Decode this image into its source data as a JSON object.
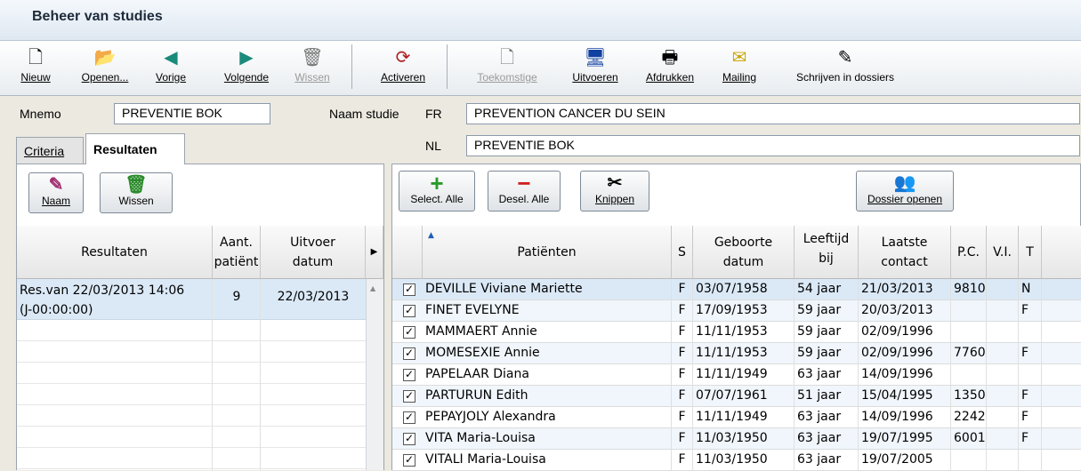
{
  "window": {
    "title": "Beheer van studies"
  },
  "toolbar": {
    "nieuw": "Nieuw",
    "openen": "Openen...",
    "vorige": "Vorige",
    "volgende": "Volgende",
    "wissen": "Wissen",
    "activeren": "Activeren",
    "toekomstige": "Toekomstige",
    "uitvoeren": "Uitvoeren",
    "afdrukken": "Afdrukken",
    "mailing": "Mailing",
    "schrijven": "Schrijven in dossiers"
  },
  "form": {
    "mnemo_label": "Mnemo",
    "mnemo_value": "PREVENTIE BOK",
    "naam_label": "Naam studie",
    "fr_label": "FR",
    "fr_value": "PREVENTION CANCER DU SEIN",
    "nl_label": "NL",
    "nl_value": "PREVENTIE BOK"
  },
  "tabs": {
    "criteria": "Criteria",
    "resultaten": "Resultaten"
  },
  "left_panel": {
    "buttons": {
      "naam": "Naam",
      "wissen": "Wissen"
    },
    "headers": {
      "resultaten": "Resultaten",
      "aant": "Aant. patiënt",
      "uitvoer": "Uitvoer datum"
    },
    "rows": [
      {
        "label_line1": "Res.van 22/03/2013 14:06",
        "label_line2": "(J-00:00:00)",
        "count": "9",
        "date": "22/03/2013"
      }
    ]
  },
  "right_panel": {
    "buttons": {
      "select_all": "Select. Alle",
      "desel_all": "Desel. Alle",
      "knippen": "Knippen",
      "dossier": "Dossier openen"
    },
    "headers": {
      "patienten": "Patiënten",
      "s": "S",
      "geboorte": "Geboorte datum",
      "leeftijd": "Leeftijd bij",
      "laatste": "Laatste contact",
      "pc": "P.C.",
      "vi": "V.I.",
      "t": "T"
    },
    "rows": [
      {
        "name": "DEVILLE Viviane Mariette",
        "s": "F",
        "dob": "03/07/1958",
        "age": "54 jaar",
        "last": "21/03/2013",
        "pc": "9810",
        "vi": "",
        "t": "N",
        "checked": true
      },
      {
        "name": "FINET EVELYNE",
        "s": "F",
        "dob": "17/09/1953",
        "age": "59 jaar",
        "last": "20/03/2013",
        "pc": "",
        "vi": "",
        "t": "F",
        "checked": true
      },
      {
        "name": "MAMMAERT Annie",
        "s": "F",
        "dob": "11/11/1953",
        "age": "59 jaar",
        "last": "02/09/1996",
        "pc": "",
        "vi": "",
        "t": "",
        "checked": true
      },
      {
        "name": "MOMESEXIE Annie",
        "s": "F",
        "dob": "11/11/1953",
        "age": "59 jaar",
        "last": "02/09/1996",
        "pc": "7760",
        "vi": "",
        "t": "F",
        "checked": true
      },
      {
        "name": "PAPELAAR Diana",
        "s": "F",
        "dob": "11/11/1949",
        "age": "63 jaar",
        "last": "14/09/1996",
        "pc": "",
        "vi": "",
        "t": "",
        "checked": true
      },
      {
        "name": "PARTURUN Edith",
        "s": "F",
        "dob": "07/07/1961",
        "age": "51 jaar",
        "last": "15/04/1995",
        "pc": "1350",
        "vi": "",
        "t": "F",
        "checked": true
      },
      {
        "name": "PEPAYJOLY Alexandra",
        "s": "F",
        "dob": "11/11/1949",
        "age": "63 jaar",
        "last": "14/09/1996",
        "pc": "2242",
        "vi": "",
        "t": "F",
        "checked": true
      },
      {
        "name": "VITA Maria-Louisa",
        "s": "F",
        "dob": "11/03/1950",
        "age": "63 jaar",
        "last": "19/07/1995",
        "pc": "6001",
        "vi": "",
        "t": "F",
        "checked": true
      },
      {
        "name": "VITALI Maria-Louisa",
        "s": "F",
        "dob": "11/03/1950",
        "age": "63 jaar",
        "last": "19/07/2005",
        "pc": "",
        "vi": "",
        "t": "",
        "checked": true
      }
    ]
  }
}
